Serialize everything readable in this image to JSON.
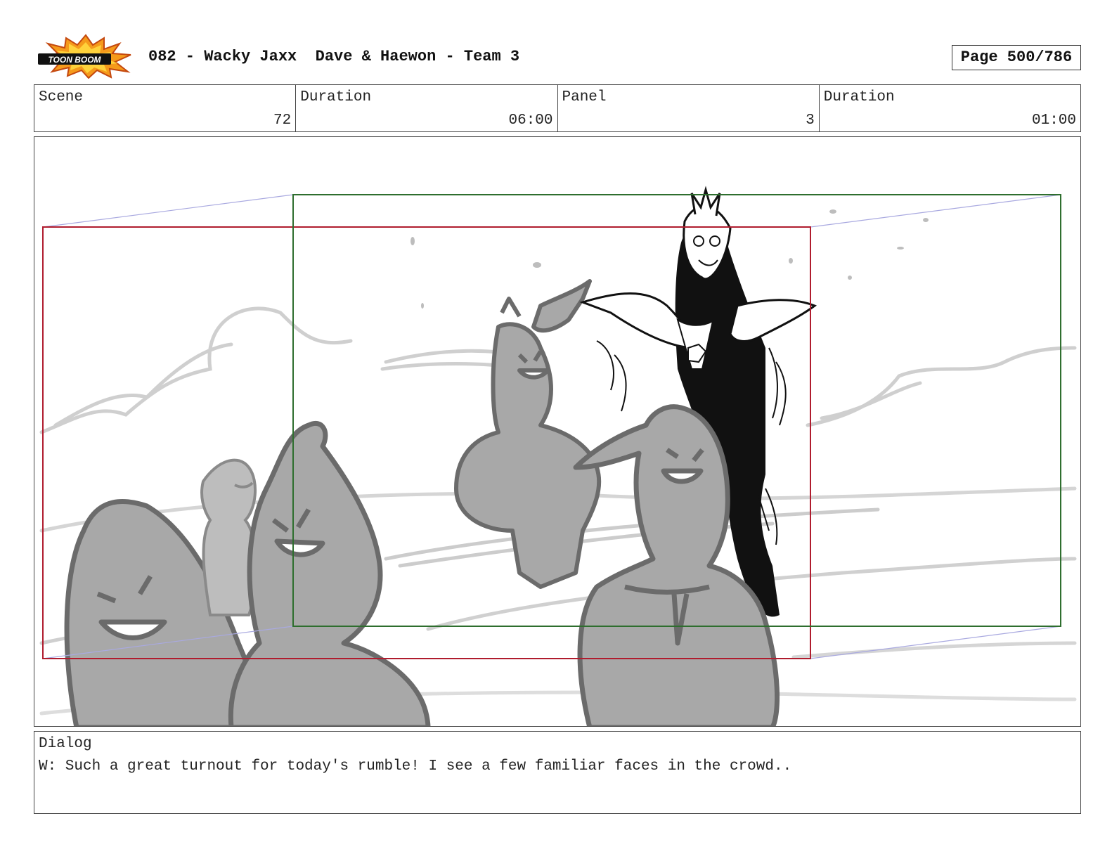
{
  "header": {
    "logo_text": "TOON BOOM",
    "title": "082 - Wacky Jaxx  Dave & Haewon - Team 3",
    "page_label": "Page 500/786"
  },
  "info": {
    "scene_label": "Scene",
    "scene_value": "72",
    "scene_duration_label": "Duration",
    "scene_duration_value": "06:00",
    "panel_label": "Panel",
    "panel_value": "3",
    "panel_duration_label": "Duration",
    "panel_duration_value": "01:00"
  },
  "panel": {
    "camera_start_color": "#b01c2e",
    "camera_end_color": "#2e6e2e",
    "motion_line_color": "#a9a9e0"
  },
  "dialog": {
    "label": "Dialog",
    "text": "W: Such a great turnout for today's rumble! I see a few familiar faces in the crowd.."
  }
}
